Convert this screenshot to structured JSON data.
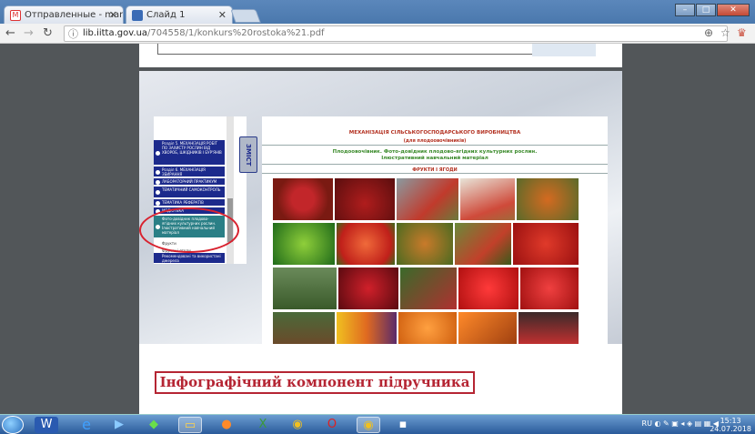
{
  "browser": {
    "tabs": [
      {
        "label": "Отправленные - marike"
      },
      {
        "label": "Слайд 1"
      }
    ],
    "address": {
      "host": "lib.iitta.gov.ua",
      "path": "/704558/1/konkurs%20rostoka%21.pdf"
    }
  },
  "menu": {
    "zmist": "ЗМІСТ",
    "items": [
      "Розділ 5. МЕХАНІЗАЦІЯ РОБІТ ПО ЗАХИСТУ РОСЛИН ВІД ХВОРОБ, ШКІДНИКІВ І БУР'ЯНІВ",
      "Розділ 6. МЕХАНІЗАЦІЯ ЗБИРАННЯ",
      "ЛАБОРАТОРНИЙ ПРАКТИКУМ",
      "ТЕМАТИЧНИЙ САМОКОНТРОЛЬ",
      "ТЕМАТИКА РЕФЕРАТІВ",
      "МЕДІОТЕКА",
      "Фото-довідник плодово-ягідних культурних рослин. Ілюстративний навчальний матеріал"
    ],
    "plain": [
      "Фрукти",
      "Фрукти і ягоди"
    ],
    "last": "Рекомендовані та використані джерела"
  },
  "content": {
    "title": "МЕХАНІЗАЦІЯ СІЛЬСЬКОГОСПОДАРСЬКОГО ВИРОБНИЦТВА",
    "subtitle": "(для плодоовочівників)",
    "desc1": "Плодоовочівник. Фото-довідник плодово-ягідних культурних рослин.",
    "desc2": "Ілюстративний навчальний матеріал",
    "section": "ФРУКТИ І ЯГОДИ"
  },
  "infographic": "Інфографічний компонент підручника",
  "taskbar": {
    "lang": "RU",
    "time": "15:13",
    "date": "24.07.2018"
  },
  "colors": {
    "accent": "#b52533",
    "menu": "#1c2a8c",
    "teal": "#2a7f86",
    "green": "#3a8a2a"
  }
}
